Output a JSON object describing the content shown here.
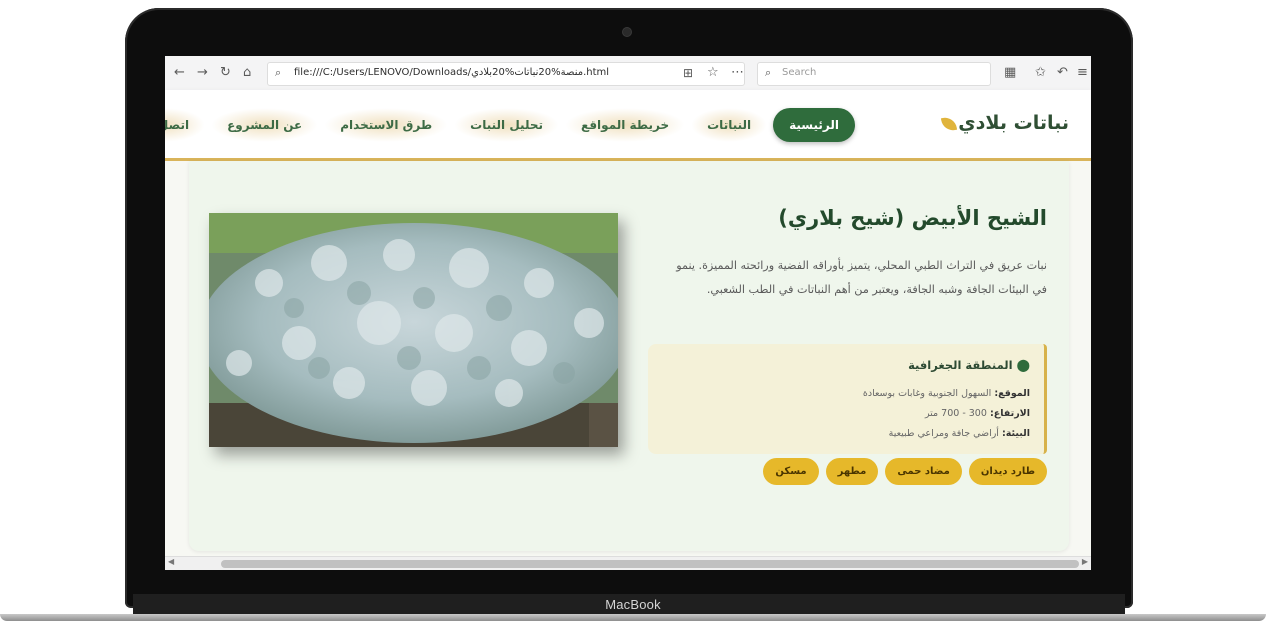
{
  "browser": {
    "url": "file:///C:/Users/LENOVO/Downloads/منصة%20نباتات%20بلادي.html",
    "search_placeholder": "Search"
  },
  "site": {
    "logo": "نباتات بلادي",
    "nav": [
      {
        "label": "الرئيسية",
        "active": true
      },
      {
        "label": "النباتات",
        "active": false
      },
      {
        "label": "خريطة المواقع",
        "active": false
      },
      {
        "label": "تحليل النبات",
        "active": false
      },
      {
        "label": "طرق الاستخدام",
        "active": false
      },
      {
        "label": "عن المشروع",
        "active": false
      },
      {
        "label": "اتصل بنا",
        "active": false
      }
    ]
  },
  "plant": {
    "title": "الشيح الأبيض (شيح بلاري)",
    "description": "نبات عريق في التراث الطبي المحلي، يتميز بأوراقه الفضية ورائحته المميزة. ينمو في البيئات الجافة وشبه الجافة، ويعتبر من أهم النباتات في الطب الشعبي.",
    "geo": {
      "title": "المنطقة الجغرافية",
      "location_label": "الموقع:",
      "location_value": "السهول الجنوبية وغابات بوسعادة",
      "altitude_label": "الارتفاع:",
      "altitude_value": "300 - 700 متر",
      "environment_label": "البيئة:",
      "environment_value": "أراضي جافة ومراعي طبيعية"
    },
    "tags": [
      "طارد ديدان",
      "مضاد حمى",
      "مطهر",
      "مسكن"
    ]
  },
  "device": {
    "brand": "MacBook"
  },
  "colors": {
    "primary_green": "#2f6c3c",
    "accent_gold": "#e6b82a",
    "card_bg": "#eff6ec"
  }
}
